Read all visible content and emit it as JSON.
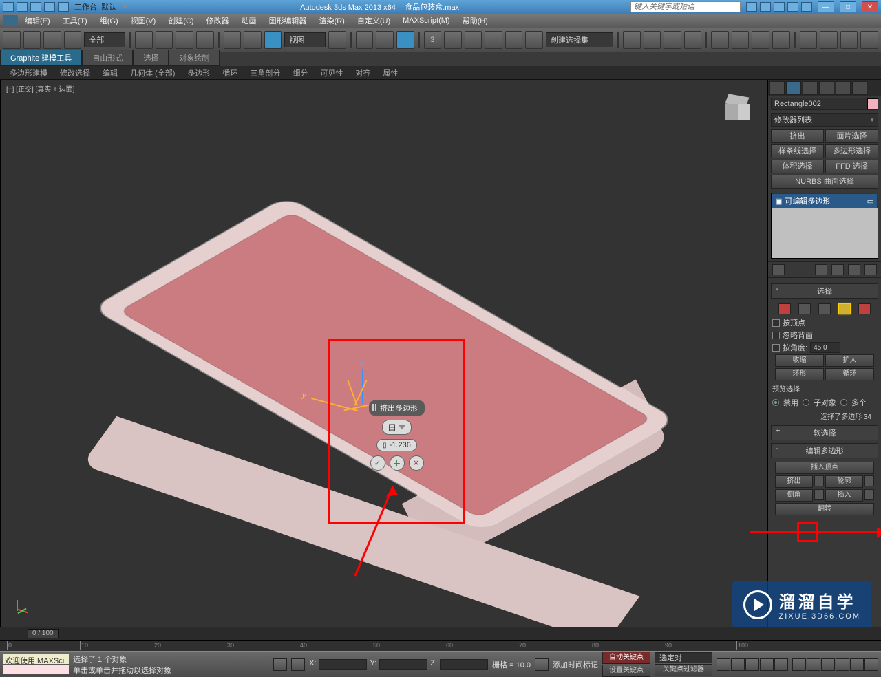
{
  "titlebar": {
    "workspace": "工作台: 默认",
    "app": "Autodesk 3ds Max  2013 x64",
    "file": "食品包装盒.max",
    "search_placeholder": "键入关键字或短语"
  },
  "menu": [
    "编辑(E)",
    "工具(T)",
    "组(G)",
    "视图(V)",
    "创建(C)",
    "修改器",
    "动画",
    "图形编辑器",
    "渲染(R)",
    "自定义(U)",
    "MAXScript(M)",
    "帮助(H)"
  ],
  "toolbar": {
    "filter": "全部",
    "ref_dropdown": "视图",
    "named_sel": "创建选择集"
  },
  "ribbon": {
    "tabs": [
      "Graphite 建模工具",
      "自由形式",
      "选择",
      "对象绘制"
    ],
    "subtabs": [
      "多边形建模",
      "修改选择",
      "编辑",
      "几何体 (全部)",
      "多边形",
      "循环",
      "三角剖分",
      "细分",
      "可见性",
      "对齐",
      "属性"
    ]
  },
  "viewport": {
    "label": "[+] [正交]   [真实 + 边面]"
  },
  "caddy": {
    "title": "挤出多边形",
    "mode_icon": "田",
    "value": "-1.236"
  },
  "panel": {
    "object_name": "Rectangle002",
    "mod_list_label": "修改器列表",
    "set_buttons": [
      "挤出",
      "面片选择",
      "样条线选择",
      "多边形选择",
      "体积选择",
      "FFD 选择"
    ],
    "nurbs_btn": "NURBS 曲面选择",
    "stack_item": "可编辑多边形",
    "rollouts": {
      "selection": {
        "title": "选择",
        "by_vertex": "按顶点",
        "ignore_backfacing": "忽略背面",
        "by_angle": "按角度:",
        "angle_value": "45.0",
        "shrink": "收缩",
        "grow": "扩大",
        "ring": "环形",
        "loop": "循环",
        "preview_label": "预览选择",
        "preview_opts": [
          "禁用",
          "子对象",
          "多个"
        ],
        "info": "选择了多边形 34"
      },
      "soft": {
        "title": "软选择"
      },
      "edit_poly": {
        "title": "编辑多边形",
        "insert_vertex": "插入顶点",
        "extrude": "挤出",
        "outline": "轮廓",
        "bevel": "倒角",
        "inset": "插入",
        "flip": "翻转"
      }
    }
  },
  "timeline": {
    "slider": "0 / 100",
    "ticks": [
      0,
      10,
      20,
      30,
      40,
      50,
      60,
      70,
      80,
      90,
      100
    ]
  },
  "status": {
    "welcome": "欢迎使用  MAXSci",
    "line1": "选择了 1 个对象",
    "line2": "单击或单击并拖动以选择对象",
    "x": "X:",
    "y": "Y:",
    "z": "Z:",
    "grid": "栅格 = 10.0",
    "autokey": "自动关键点",
    "selected_pair": "选定对",
    "setkey": "设置关键点",
    "keyfilters": "关键点过滤器",
    "addtimemark": "添加时间标记"
  },
  "watermark": {
    "big": "溜溜自学",
    "small": "ZIXUE.3D66.COM"
  }
}
